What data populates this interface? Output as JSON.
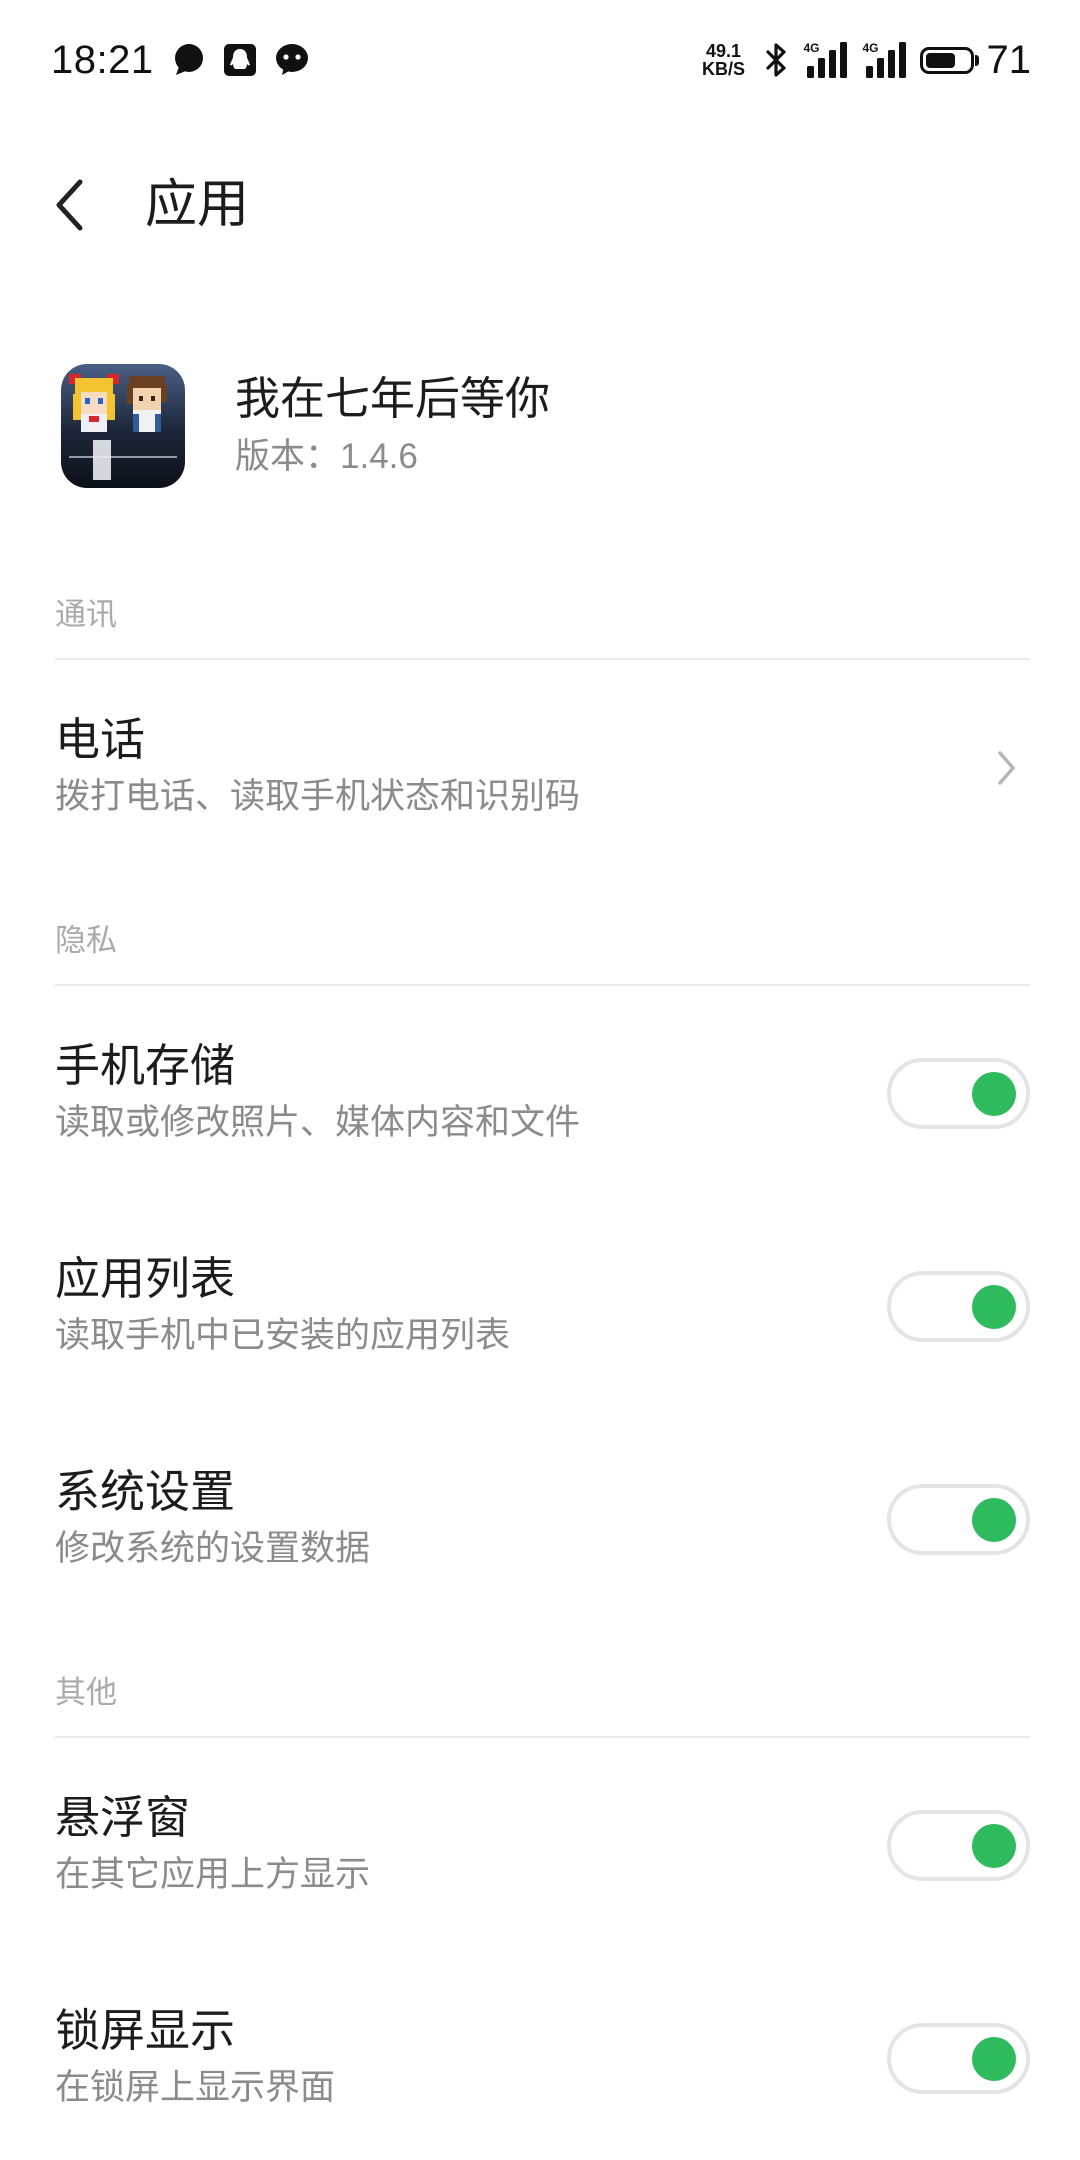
{
  "status_bar": {
    "time": "18:21",
    "notifications": [
      {
        "icon": "chat-bubble-icon"
      },
      {
        "icon": "qq-icon"
      },
      {
        "icon": "wechat-icon"
      }
    ],
    "net_speed": {
      "value": "49.1",
      "unit": "KB/S"
    },
    "bluetooth_icon": "bluetooth-icon",
    "sim_cards": [
      {
        "network": "4G",
        "signal_bars": 4
      },
      {
        "network": "4G",
        "signal_bars": 4
      }
    ],
    "battery": {
      "percent": "71"
    }
  },
  "header": {
    "back_icon": "chevron-left-icon",
    "title": "应用"
  },
  "app": {
    "icon": "app-icon",
    "name": "我在七年后等你",
    "version": "版本：1.4.6"
  },
  "sections": [
    {
      "title": "通讯",
      "items": [
        {
          "title": "电话",
          "desc": "拨打电话、读取手机状态和识别码",
          "trailing_icon": "chevron-right-icon"
        }
      ]
    },
    {
      "title": "隐私",
      "items": [
        {
          "title": "手机存储",
          "desc": "读取或修改照片、媒体内容和文件",
          "toggle_on": true
        },
        {
          "title": "应用列表",
          "desc": "读取手机中已安装的应用列表",
          "toggle_on": true
        },
        {
          "title": "系统设置",
          "desc": "修改系统的设置数据",
          "toggle_on": true
        }
      ]
    },
    {
      "title": "其他",
      "items": [
        {
          "title": "悬浮窗",
          "desc": "在其它应用上方显示",
          "toggle_on": true
        },
        {
          "title": "锁屏显示",
          "desc": "在锁屏上显示界面",
          "toggle_on": true
        }
      ]
    }
  ],
  "colors": {
    "background": "#ffffff",
    "text_primary": "#1c1c1c",
    "text_secondary": "#8b8b8b",
    "section_title": "#aaaaaa",
    "divider": "#ebebeb",
    "toggle_border": "#e4e4e4",
    "toggle_on": "#2dbb5d",
    "chevron": "#b7b7b7"
  }
}
